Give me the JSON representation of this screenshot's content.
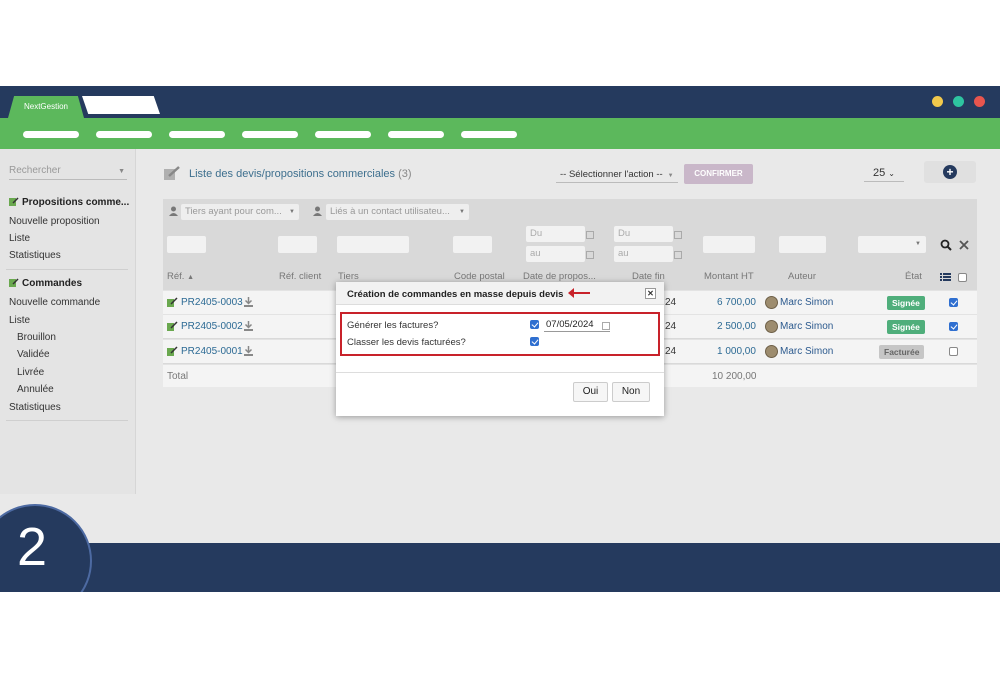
{
  "app": {
    "tab_label": "NextGestion",
    "window_dots": [
      "#f2c94c",
      "#2ec4a0",
      "#e8554e"
    ]
  },
  "sidebar": {
    "search_placeholder": "Rechercher",
    "section1_title": "Propositions comme...",
    "section1_items": [
      "Nouvelle proposition",
      "Liste",
      "Statistiques"
    ],
    "section2_title": "Commandes",
    "section2_items": [
      "Nouvelle commande",
      "Liste"
    ],
    "section2_sub": [
      "Brouillon",
      "Validée",
      "Livrée",
      "Annulée"
    ],
    "section2_tail": "Statistiques"
  },
  "header": {
    "title": "Liste des devis/propositions commerciales",
    "count": "(3)",
    "action_select": "-- Sélectionner l'action --",
    "confirm_label": "CONFIRMER",
    "limit": "25"
  },
  "filters": {
    "tiers_placeholder": "Tiers ayant pour com...",
    "contact_placeholder": "Liés à un contact utilisateu...",
    "du": "Du",
    "au": "au"
  },
  "table": {
    "columns": {
      "ref": "Réf.",
      "ref_client": "Réf. client",
      "tiers": "Tiers",
      "code_postal": "Code postal",
      "date_propos": "Date de propos...",
      "date_fin": "Date fin",
      "montant_ht": "Montant HT",
      "auteur": "Auteur",
      "etat": "État"
    },
    "rows": [
      {
        "ref": "PR2405-0003",
        "date_fin_frag": "24",
        "montant": "6 700,00",
        "auteur": "Marc Simon",
        "etat": "Signée",
        "checked": true
      },
      {
        "ref": "PR2405-0002",
        "date_fin_frag": "24",
        "montant": "2 500,00",
        "auteur": "Marc Simon",
        "etat": "Signée",
        "checked": true
      },
      {
        "ref": "PR2405-0001",
        "date_fin_frag": "24",
        "montant": "1 000,00",
        "auteur": "Marc Simon",
        "etat": "Facturée",
        "checked": false
      }
    ],
    "total_label": "Total",
    "total_value": "10 200,00"
  },
  "modal": {
    "title": "Création de commandes en masse depuis devis",
    "field1_label": "Générer les factures?",
    "field1_date": "07/05/2024",
    "field2_label": "Classer les devis facturées?",
    "yes_label": "Oui",
    "no_label": "Non"
  },
  "step": {
    "number": "2"
  },
  "colors": {
    "navy": "#253a5e",
    "green": "#5cb85c",
    "signed": "#4fae7b",
    "invoiced": "#c6c6c6",
    "accent_red": "#c8222a"
  }
}
